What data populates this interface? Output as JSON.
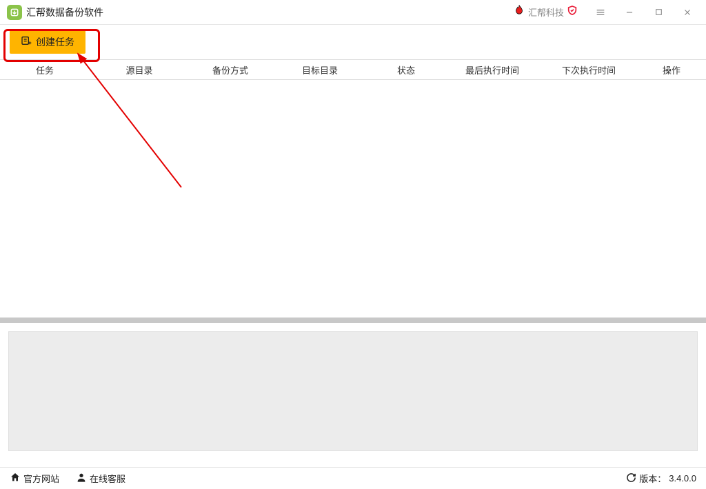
{
  "app": {
    "title": "汇帮数据备份软件"
  },
  "brand": {
    "text": "汇帮科技"
  },
  "toolbar": {
    "create_task_label": "创建任务"
  },
  "table": {
    "headers": {
      "task": "任务",
      "source_dir": "源目录",
      "backup_mode": "备份方式",
      "target_dir": "目标目录",
      "status": "状态",
      "last_exec_time": "最后执行时间",
      "next_exec_time": "下次执行时间",
      "actions": "操作"
    }
  },
  "statusbar": {
    "official_site": "官方网站",
    "online_support": "在线客服",
    "version_label": "版本：",
    "version": "3.4.0.0"
  }
}
